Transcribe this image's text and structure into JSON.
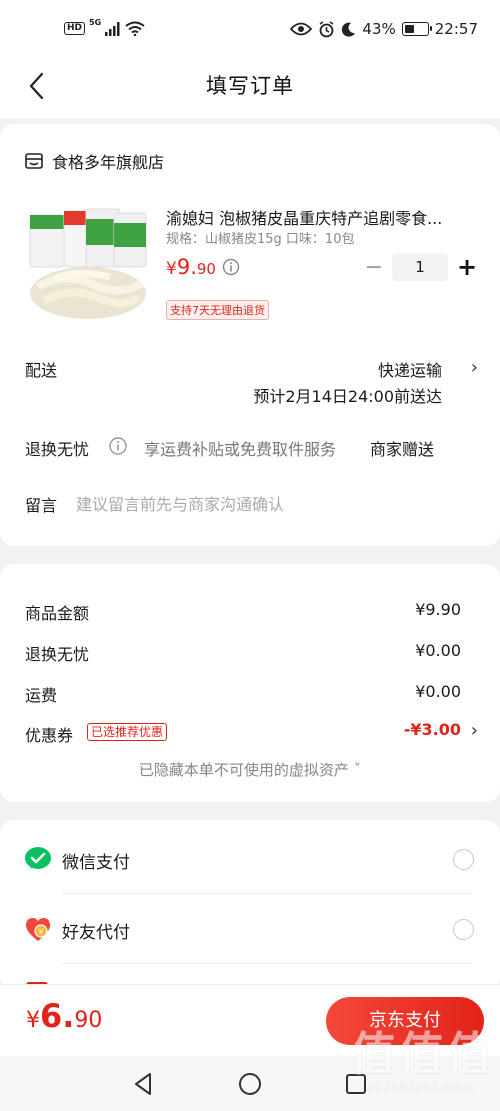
{
  "status_bar": {
    "hd": "HD",
    "signal": "5G",
    "battery": "43%",
    "battery_level": 0.43,
    "time": "22:57"
  },
  "header": {
    "title": "填写订单"
  },
  "store": {
    "name": "食格多年旗舰店"
  },
  "product": {
    "name": "渝媳妇 泡椒猪皮晶重庆特产追剧零食...",
    "spec": "规格：山椒猪皮15g  口味：10包",
    "price_symbol": "¥",
    "price_int": "9.",
    "price_dec": "90",
    "quantity": "1",
    "return_badge": "支持7天无理由退货"
  },
  "delivery": {
    "label": "配送",
    "method": "快递运输",
    "eta": "预计2月14日24:00前送达"
  },
  "refund": {
    "label": "退换无忧",
    "desc": "享运费补贴或免费取件服务",
    "gift": "商家赠送"
  },
  "note": {
    "label": "留言",
    "placeholder": "建议留言前先与商家沟通确认"
  },
  "summary": {
    "rows": [
      {
        "label": "商品金额",
        "value": "¥9.90"
      },
      {
        "label": "退换无忧",
        "value": "¥0.00"
      },
      {
        "label": "运费",
        "value": "¥0.00"
      }
    ],
    "coupon_label": "优惠券",
    "coupon_badge": "已选推荐优惠",
    "coupon_value": "-¥3.00",
    "hidden_assets": "已隐藏本单不可使用的虚拟资产 ˇ"
  },
  "payment": {
    "methods": [
      {
        "label": "微信支付"
      },
      {
        "label": "好友代付"
      }
    ]
  },
  "footer": {
    "total_symbol": "¥",
    "total_int": "6.",
    "total_dec": "90",
    "pay_button": "京东支付"
  },
  "watermark": {
    "text": "值值值",
    "url": "zhizhizhi.com"
  },
  "colors": {
    "accent": "#e2231a",
    "wechat": "#07c160"
  }
}
